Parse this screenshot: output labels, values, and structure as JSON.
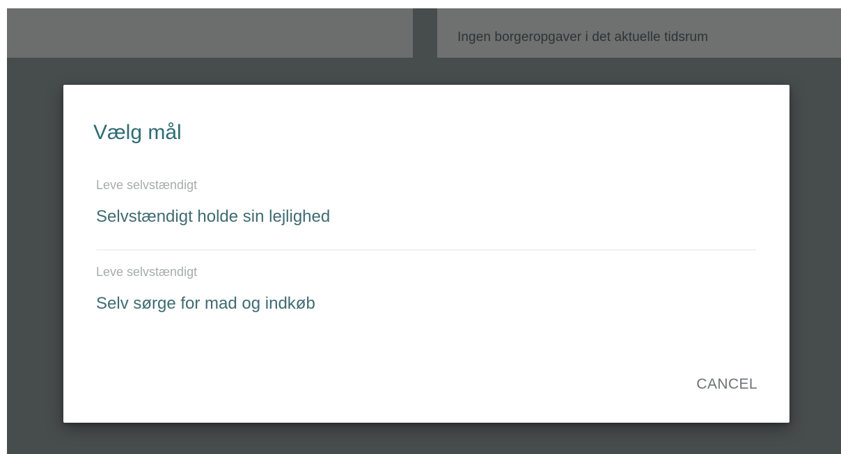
{
  "background": {
    "right_card_text": "Ingen borgeropgaver i det aktuelle tidsrum"
  },
  "dialog": {
    "title": "Vælg mål",
    "items": [
      {
        "category": "Leve selvstændigt",
        "name": "Selvstændigt holde sin lejlighed"
      },
      {
        "category": "Leve selvstændigt",
        "name": "Selv sørge for mad og indkøb"
      }
    ],
    "cancel_label": "CANCEL"
  },
  "colors": {
    "accent": "#2e6b74",
    "overlay": "#474c4c"
  }
}
